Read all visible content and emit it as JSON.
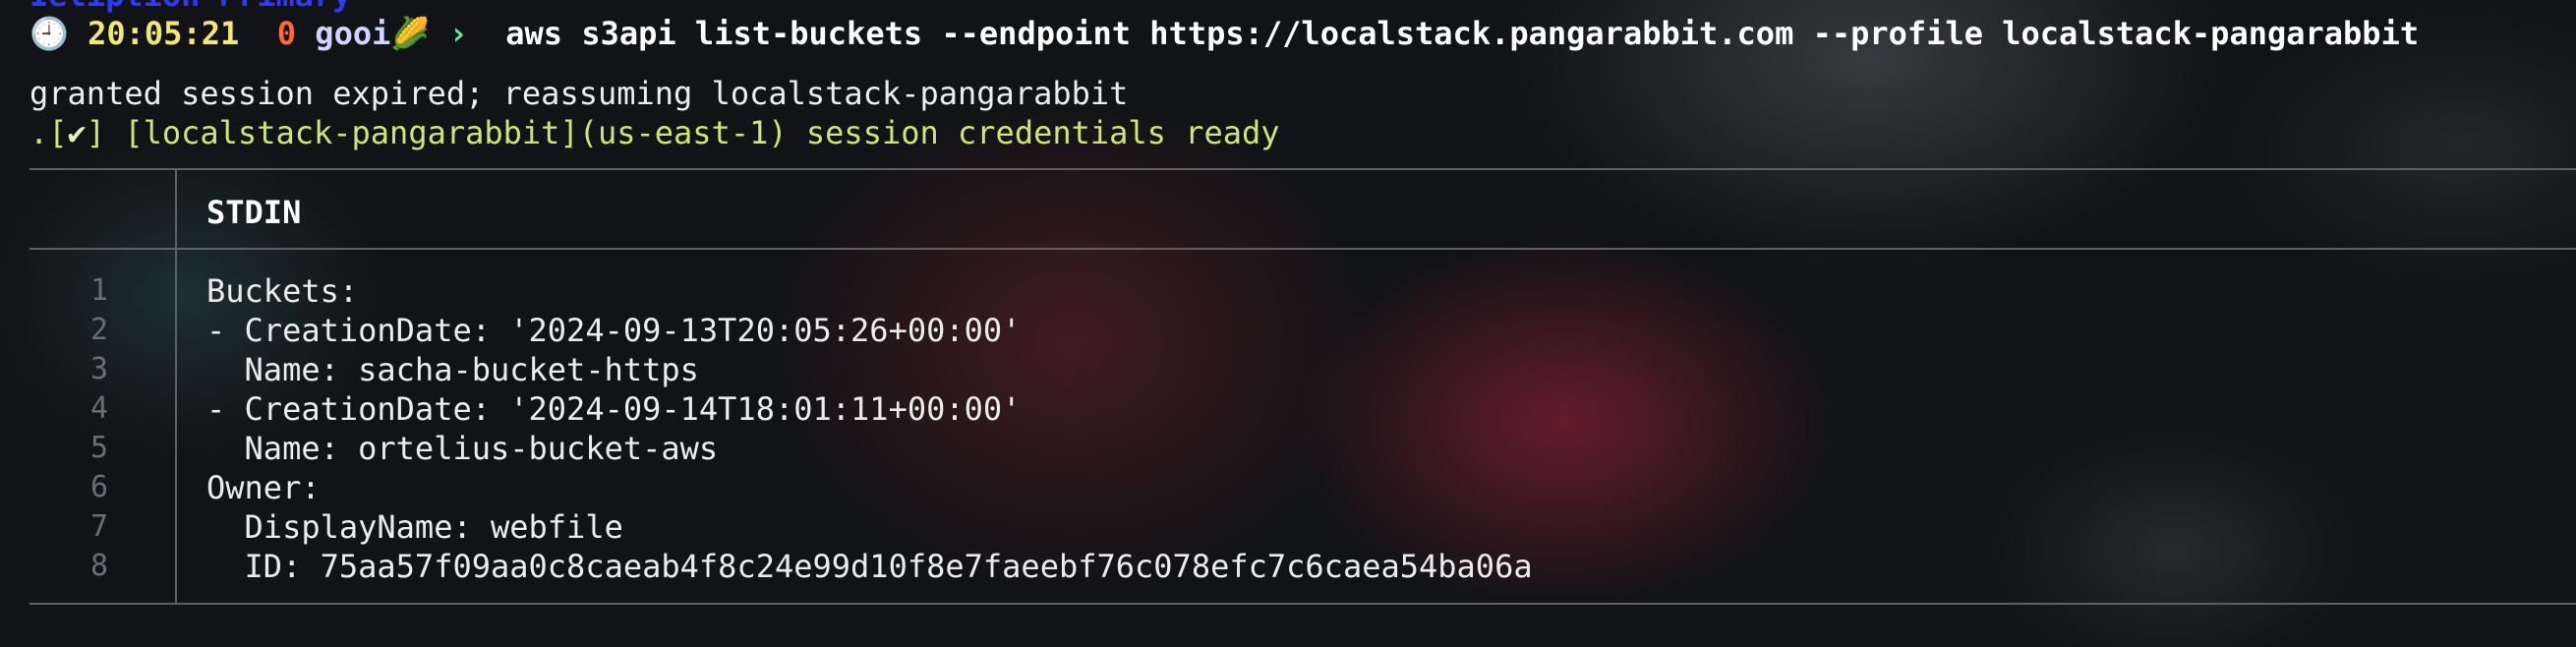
{
  "terminal": {
    "top_cut_text": "Ieliption Primary",
    "prompt": {
      "clock": "🕘",
      "time": "20:05:21",
      "exit_status": "0",
      "user": "gooi",
      "user_emoji": "🌽",
      "chevron": "›",
      "command": "aws s3api list-buckets --endpoint https://localstack.pangarabbit.com --profile localstack-pangarabbit"
    },
    "messages": [
      "granted session expired; reassuming localstack-pangarabbit",
      {
        "prefix": ".[",
        "check": "✔",
        "rest": "] [localstack-pangarabbit](us-east-1) session credentials ready"
      }
    ]
  },
  "output_panel": {
    "header": "STDIN",
    "lines": [
      {
        "num": "1",
        "text": "Buckets:"
      },
      {
        "num": "2",
        "text": "- CreationDate: '2024-09-13T20:05:26+00:00'"
      },
      {
        "num": "3",
        "text": "  Name: sacha-bucket-https"
      },
      {
        "num": "4",
        "text": "- CreationDate: '2024-09-14T18:01:11+00:00'"
      },
      {
        "num": "5",
        "text": "  Name: ortelius-bucket-aws"
      },
      {
        "num": "6",
        "text": "Owner:"
      },
      {
        "num": "7",
        "text": "  DisplayName: webfile"
      },
      {
        "num": "8",
        "text": "  ID: 75aa57f09aa0c8caeab4f8c24e99d10f8e7faeebf76c078efc7c6caea54ba06a"
      }
    ]
  },
  "colors": {
    "background": "#121316",
    "time": "#f2e86a",
    "exit_status": "#ff6b35",
    "chevron": "#5ef0a6",
    "success_text": "#cde86f",
    "line_number": "#6b6d72",
    "rule": "#5f6064"
  }
}
